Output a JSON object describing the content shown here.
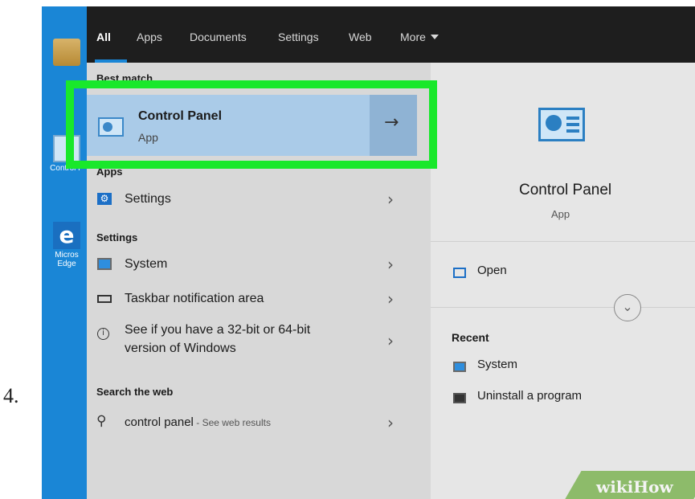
{
  "step_number": "4.",
  "desktop": {
    "icons": [
      {
        "label": "",
        "icon": "folder-icon"
      },
      {
        "label": "Control P",
        "icon": "control-panel-icon"
      },
      {
        "label": "Micros Edge",
        "icon": "edge-icon"
      }
    ]
  },
  "tabs": [
    {
      "label": "All",
      "active": true
    },
    {
      "label": "Apps"
    },
    {
      "label": "Documents"
    },
    {
      "label": "Settings"
    },
    {
      "label": "Web"
    },
    {
      "label": "More"
    }
  ],
  "left": {
    "best_match_header": "Best match",
    "best_match": {
      "title": "Control Panel",
      "subtitle": "App",
      "arrow": "→"
    },
    "apps_header": "Apps",
    "apps_items": [
      {
        "label": "Settings",
        "icon": "gear-icon"
      }
    ],
    "settings_header": "Settings",
    "settings_items": [
      {
        "label": "System",
        "icon": "monitor-icon"
      },
      {
        "label": "Taskbar notification area",
        "icon": "taskbar-icon"
      },
      {
        "label_line1": "See if you have a 32-bit or 64-bit",
        "label_line2": "version of Windows",
        "icon": "info-icon"
      }
    ],
    "web_header": "Search the web",
    "web_item": {
      "query": "control panel",
      "suffix": " - See web results",
      "icon": "search-icon"
    }
  },
  "right": {
    "title": "Control Panel",
    "subtitle": "App",
    "open_label": "Open",
    "recent_header": "Recent",
    "recent_items": [
      {
        "label": "System",
        "icon": "monitor-icon"
      },
      {
        "label": "Uninstall a program",
        "icon": "uninstall-icon"
      }
    ]
  },
  "watermark": {
    "text": "wikiHow"
  },
  "colors": {
    "highlight": "#19e82b",
    "desktop_bg": "#1a86d6",
    "topbar_bg": "#1e1e1e",
    "selected_bg": "#aacbe8"
  }
}
